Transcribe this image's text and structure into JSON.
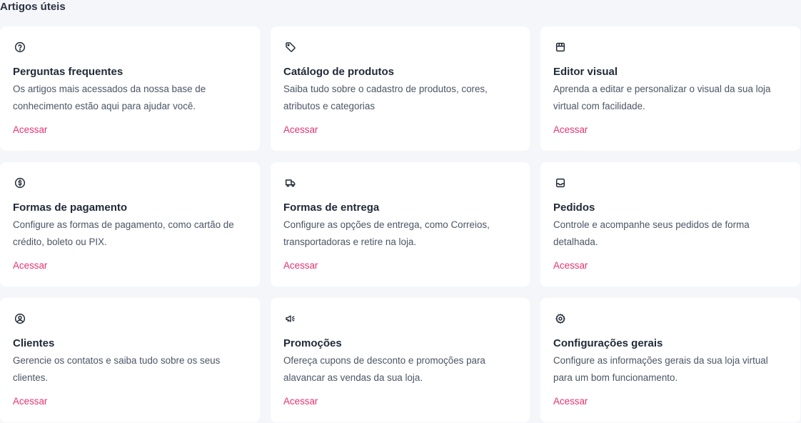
{
  "page": {
    "heading": "Artigos úteis"
  },
  "cards": [
    {
      "icon": "question-circle-icon",
      "title": "Perguntas frequentes",
      "description": "Os artigos mais acessados da nossa base de conhecimento estão aqui para ajudar você.",
      "link": "Acessar"
    },
    {
      "icon": "tag-icon",
      "title": "Catálogo de produtos",
      "description": "Saiba tudo sobre o cadastro de produtos, cores, atributos e categorias",
      "link": "Acessar"
    },
    {
      "icon": "storefront-icon",
      "title": "Editor visual",
      "description": "Aprenda a editar e personalizar o visual da sua loja virtual com facilidade.",
      "link": "Acessar"
    },
    {
      "icon": "dollar-circle-icon",
      "title": "Formas de pagamento",
      "description": "Configure as formas de pagamento, como cartão de crédito, boleto ou PIX.",
      "link": "Acessar"
    },
    {
      "icon": "truck-icon",
      "title": "Formas de entrega",
      "description": "Configure as opções de entrega, como Correios, transportadoras e retire na loja.",
      "link": "Acessar"
    },
    {
      "icon": "inbox-icon",
      "title": "Pedidos",
      "description": "Controle e acompanhe seus pedidos de forma detalhada.",
      "link": "Acessar"
    },
    {
      "icon": "user-circle-icon",
      "title": "Clientes",
      "description": "Gerencie os contatos e saiba tudo sobre os seus clientes.",
      "link": "Acessar"
    },
    {
      "icon": "megaphone-icon",
      "title": "Promoções",
      "description": "Ofereça cupons de desconto e promoções para alavancar as vendas da sua loja.",
      "link": "Acessar"
    },
    {
      "icon": "gear-icon",
      "title": "Configurações gerais",
      "description": "Configure as informações gerais da sua loja virtual para um bom funcionamento.",
      "link": "Acessar"
    }
  ],
  "colors": {
    "link": "#e6336f",
    "card_bg": "#ffffff",
    "page_bg": "#f4f6fa",
    "icon": "#1f2937"
  }
}
